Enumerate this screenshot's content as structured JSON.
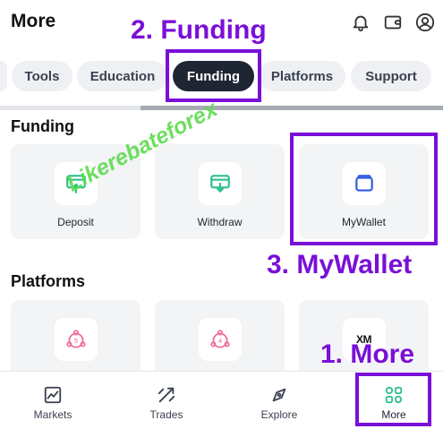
{
  "header": {
    "title": "More",
    "bell_icon": "bell-icon",
    "wallet_icon": "wallet-icon",
    "profile_icon": "user-circle-icon"
  },
  "tabs": [
    {
      "label": "Tools",
      "active": false
    },
    {
      "label": "Education",
      "active": false
    },
    {
      "label": "Funding",
      "active": true
    },
    {
      "label": "Platforms",
      "active": false
    },
    {
      "label": "Support",
      "active": false
    }
  ],
  "funding": {
    "title": "Funding",
    "cards": [
      {
        "label": "Deposit",
        "icon": "deposit-icon"
      },
      {
        "label": "Withdraw",
        "icon": "withdraw-icon"
      },
      {
        "label": "MyWallet",
        "icon": "mywallet-icon"
      }
    ]
  },
  "platforms": {
    "title": "Platforms",
    "cards": [
      {
        "icon": "mt5-icon",
        "icon_text": "5"
      },
      {
        "icon": "mt4-icon",
        "icon_text": "4"
      },
      {
        "icon": "xm-logo-icon",
        "icon_text": "XM"
      }
    ]
  },
  "bottom_nav": [
    {
      "label": "Markets",
      "icon": "chart-icon"
    },
    {
      "label": "Trades",
      "icon": "trades-arrows-icon"
    },
    {
      "label": "Explore",
      "icon": "compass-icon"
    },
    {
      "label": "More",
      "icon": "grid-icon",
      "active": true
    }
  ],
  "annotations": {
    "step2": "2. Funding",
    "step3": "3. MyWallet",
    "step1": "1. More",
    "watermark": "Likerebateforex"
  },
  "colors": {
    "accent_green": "#2ebf8e",
    "accent_blue": "#2d5be3",
    "accent_pink": "#f06a9a",
    "annotation_purple": "#7a0fd8",
    "watermark_green": "#5cdc4e",
    "active_tab": "#1f2633"
  }
}
